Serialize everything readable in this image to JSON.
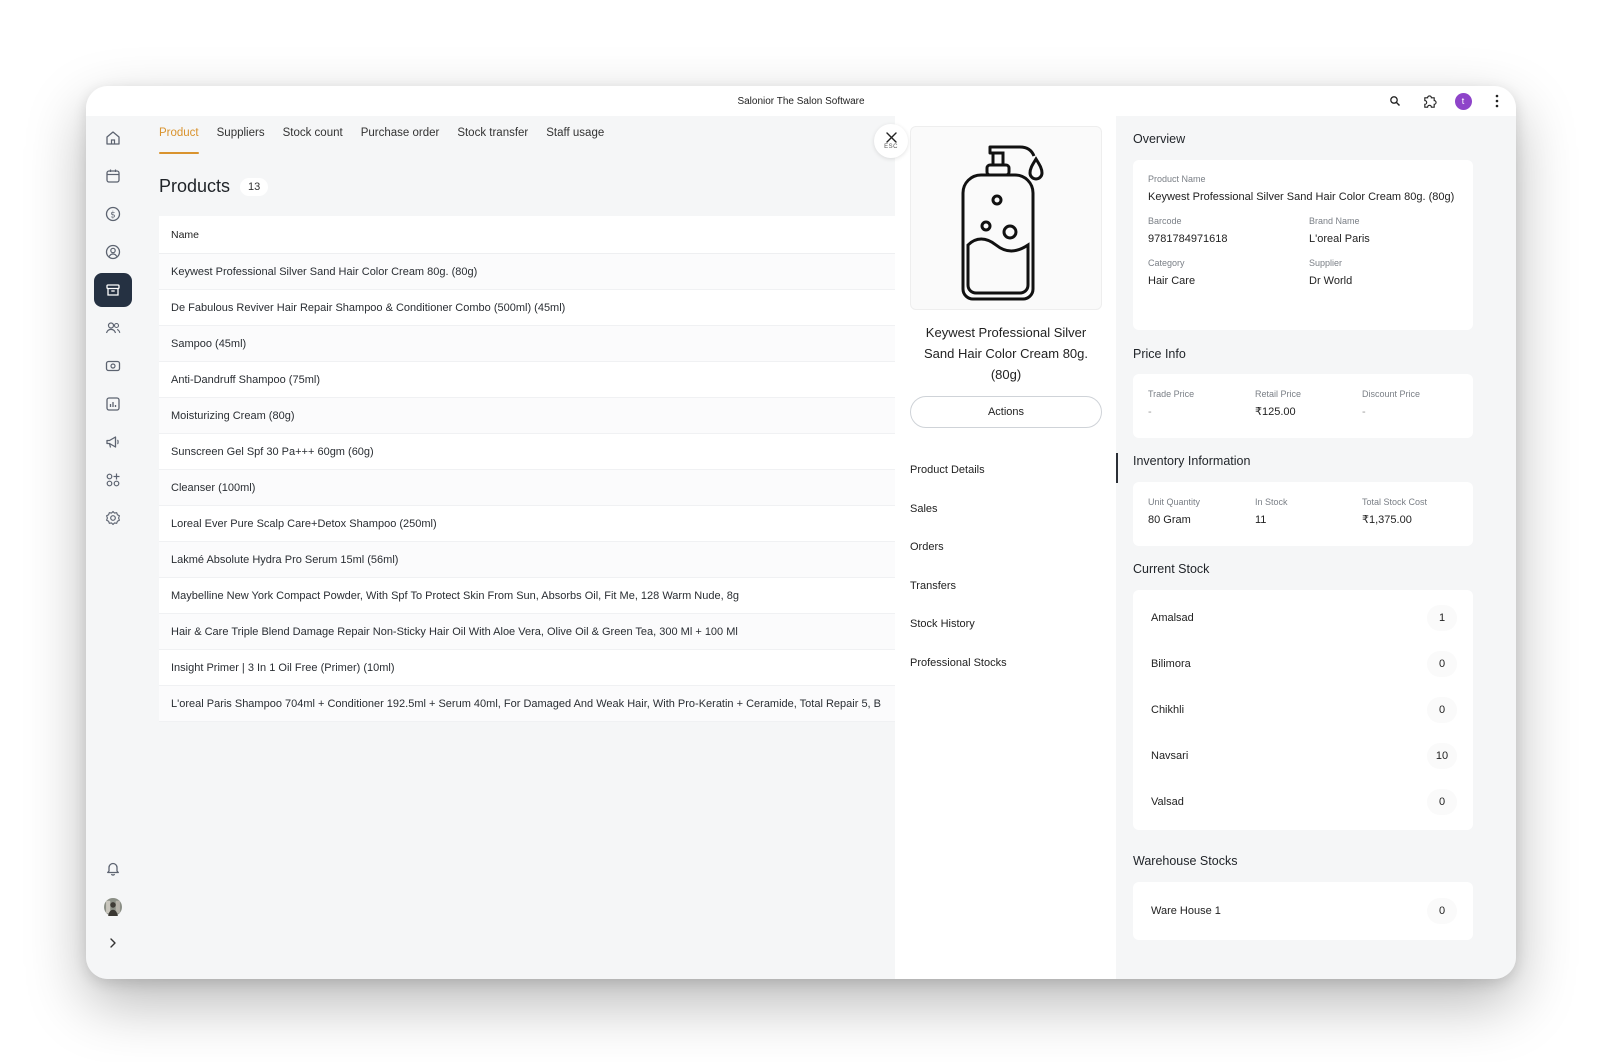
{
  "window": {
    "title": "Salonior The Salon Software",
    "profile_initial": "t"
  },
  "nav": {
    "items": [
      {
        "icon": "home-icon"
      },
      {
        "icon": "calendar-icon"
      },
      {
        "icon": "dollar-icon"
      },
      {
        "icon": "user-circle-icon"
      },
      {
        "icon": "archive-box-icon",
        "active": true
      },
      {
        "icon": "users-icon"
      },
      {
        "icon": "money-icon"
      },
      {
        "icon": "reports-icon"
      },
      {
        "icon": "megaphone-icon"
      },
      {
        "icon": "apps-add-icon"
      },
      {
        "icon": "settings-gear-icon"
      }
    ],
    "bottom": [
      "bell-icon",
      "avatar",
      "chevron-right-icon"
    ]
  },
  "tabs": [
    "Product",
    "Suppliers",
    "Stock count",
    "Purchase order",
    "Stock transfer",
    "Staff usage"
  ],
  "active_tab": "Product",
  "products": {
    "title": "Products",
    "count": "13",
    "column_header": "Name",
    "rows": [
      "Keywest Professional Silver Sand Hair Color Cream 80g. (80g)",
      "De Fabulous Reviver Hair Repair Shampoo & Conditioner Combo (500ml) (45ml)",
      "Sampoo (45ml)",
      "Anti-Dandruff Shampoo (75ml)",
      "Moisturizing Cream (80g)",
      "Sunscreen Gel Spf 30 Pa+++ 60gm (60g)",
      "Cleanser (100ml)",
      "Loreal Ever Pure Scalp Care+Detox Shampoo (250ml)",
      "Lakmé Absolute Hydra Pro Serum 15ml (56ml)",
      "Maybelline New York Compact Powder, With Spf To Protect Skin From Sun, Absorbs Oil, Fit Me, 128 Warm Nude, 8g",
      "Hair & Care Triple Blend Damage Repair Non-Sticky Hair Oil With Aloe Vera, Olive Oil & Green Tea, 300 Ml + 100 Ml",
      "Insight Primer | 3 In 1 Oil Free (Primer) (10ml)",
      "L'oreal Paris Shampoo 704ml + Conditioner 192.5ml + Serum 40ml, For Damaged And Weak Hair, With Pro-Keratin + Ceramide, Total Repair 5, B"
    ]
  },
  "close": {
    "esc_label": "ESC"
  },
  "detail": {
    "product_name": "Keywest Professional Silver Sand Hair Color Cream 80g. (80g)",
    "actions_label": "Actions",
    "menu": [
      "Product Details",
      "Sales",
      "Orders",
      "Transfers",
      "Stock History",
      "Professional Stocks"
    ]
  },
  "overview": {
    "title": "Overview",
    "product_name_label": "Product Name",
    "product_name": "Keywest Professional Silver Sand Hair Color Cream 80g. (80g)",
    "barcode_label": "Barcode",
    "barcode": "9781784971618",
    "brand_label": "Brand Name",
    "brand": "L'oreal Paris",
    "category_label": "Category",
    "category": "Hair Care",
    "supplier_label": "Supplier",
    "supplier": "Dr World"
  },
  "price_info": {
    "title": "Price Info",
    "trade_label": "Trade Price",
    "trade": "-",
    "retail_label": "Retail Price",
    "retail": "₹125.00",
    "discount_label": "Discount Price",
    "discount": "-"
  },
  "inventory": {
    "title": "Inventory Information",
    "unit_label": "Unit Quantity",
    "unit": "80 Gram",
    "instock_label": "In Stock",
    "instock": "11",
    "cost_label": "Total Stock Cost",
    "cost": "₹1,375.00"
  },
  "current_stock": {
    "title": "Current Stock",
    "rows": [
      {
        "name": "Amalsad",
        "qty": "1"
      },
      {
        "name": "Bilimora",
        "qty": "0"
      },
      {
        "name": "Chikhli",
        "qty": "0"
      },
      {
        "name": "Navsari",
        "qty": "10"
      },
      {
        "name": "Valsad",
        "qty": "0"
      }
    ]
  },
  "warehouse": {
    "title": "Warehouse Stocks",
    "rows": [
      {
        "name": "Ware House 1",
        "qty": "0"
      }
    ]
  },
  "colors": {
    "accent": "#d9932e",
    "nav_active": "#253142",
    "profile": "#8e44c9"
  }
}
